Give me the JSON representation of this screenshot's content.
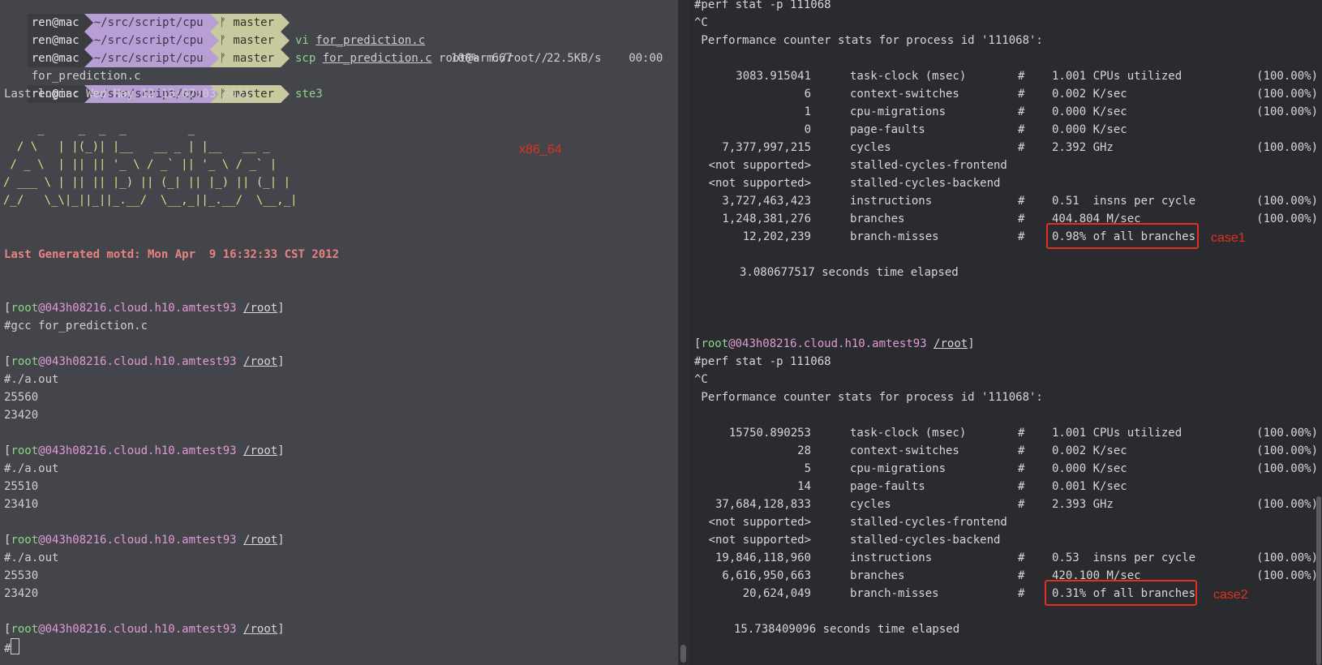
{
  "left": {
    "prompt": {
      "user": "ren@mac",
      "path": "~/src/script/cpu",
      "git": "ᚠ master"
    },
    "prompt_lines": [
      {
        "cmd": "",
        "arg": "",
        "rest": ""
      },
      {
        "cmd": "vi",
        "arg": "for_prediction.c",
        "rest": ""
      },
      {
        "cmd": "scp",
        "arg": "for_prediction.c",
        "rest": " root@arm:/root//"
      }
    ],
    "scp_progress": {
      "file": "for_prediction.c",
      "percent": "100%",
      "size": "667",
      "rate": "22.5KB/s",
      "time": "00:00"
    },
    "prompt_ssh": {
      "cmd": "ste3"
    },
    "last_login": "Last login: Wed May 12 13:07:03 2021",
    "ascii_art": "     _     _  _  _         _\n  / \\   | |(_)| |__   __ _ | |__   __ _\n / _ \\  | || || '_ \\ / _` || '_ \\ / _` |\n/ ___ \\ | || || |_) || (_| || |_) || (_| |\n/_/   \\_\\|_||_||_.__/  \\__,_||_.__/  \\__,_|",
    "arch_label": "x86_64",
    "motd": "Last Generated motd: Mon Apr  9 16:32:33 CST 2012",
    "host_prompt": {
      "user": "root",
      "at": "@",
      "host": "043h08216.cloud.h10.amtest93",
      "path": "/root"
    },
    "sessions": [
      {
        "cmd": "#gcc for_prediction.c",
        "out": []
      },
      {
        "cmd": "#./a.out",
        "out": [
          "25560",
          "23420"
        ]
      },
      {
        "cmd": "#./a.out",
        "out": [
          "25510",
          "23410"
        ]
      },
      {
        "cmd": "#./a.out",
        "out": [
          "25530",
          "23420"
        ]
      }
    ],
    "final_prompt": "#"
  },
  "right": {
    "top_cmd": "#perf stat -p 111068",
    "ctrl_c": "^C",
    "header": " Performance counter stats for process id '111068':",
    "case1": {
      "rows": [
        {
          "value": "3083.915041",
          "event": "task-clock (msec)",
          "hash": "#",
          "metric": "1.001 CPUs utilized",
          "pct": "(100.00%)"
        },
        {
          "value": "6",
          "event": "context-switches",
          "hash": "#",
          "metric": "0.002 K/sec",
          "pct": "(100.00%)"
        },
        {
          "value": "1",
          "event": "cpu-migrations",
          "hash": "#",
          "metric": "0.000 K/sec",
          "pct": "(100.00%)"
        },
        {
          "value": "0",
          "event": "page-faults",
          "hash": "#",
          "metric": "0.000 K/sec",
          "pct": ""
        },
        {
          "value": "7,377,997,215",
          "event": "cycles",
          "hash": "#",
          "metric": "2.392 GHz",
          "pct": "(100.00%)"
        },
        {
          "value": "<not supported>",
          "event": "stalled-cycles-frontend",
          "hash": "",
          "metric": "",
          "pct": ""
        },
        {
          "value": "<not supported>",
          "event": "stalled-cycles-backend",
          "hash": "",
          "metric": "",
          "pct": ""
        },
        {
          "value": "3,727,463,423",
          "event": "instructions",
          "hash": "#",
          "metric": "0.51  insns per cycle",
          "pct": "(100.00%)"
        },
        {
          "value": "1,248,381,276",
          "event": "branches",
          "hash": "#",
          "metric": "404.804 M/sec",
          "pct": "(100.00%)"
        },
        {
          "value": "12,202,239",
          "event": "branch-misses",
          "hash": "#",
          "metric": "0.98% of all branches",
          "pct": ""
        }
      ],
      "elapsed": "3.080677517 seconds time elapsed",
      "label": "case1"
    },
    "prompt": {
      "user": "root",
      "at": "@",
      "host": "043h08216.cloud.h10.amtest93",
      "path": "/root"
    },
    "second_cmd": "#perf stat -p 111068",
    "case2": {
      "rows": [
        {
          "value": "15750.890253",
          "event": "task-clock (msec)",
          "hash": "#",
          "metric": "1.001 CPUs utilized",
          "pct": "(100.00%)"
        },
        {
          "value": "28",
          "event": "context-switches",
          "hash": "#",
          "metric": "0.002 K/sec",
          "pct": "(100.00%)"
        },
        {
          "value": "5",
          "event": "cpu-migrations",
          "hash": "#",
          "metric": "0.000 K/sec",
          "pct": "(100.00%)"
        },
        {
          "value": "14",
          "event": "page-faults",
          "hash": "#",
          "metric": "0.001 K/sec",
          "pct": ""
        },
        {
          "value": "37,684,128,833",
          "event": "cycles",
          "hash": "#",
          "metric": "2.393 GHz",
          "pct": "(100.00%)"
        },
        {
          "value": "<not supported>",
          "event": "stalled-cycles-frontend",
          "hash": "",
          "metric": "",
          "pct": ""
        },
        {
          "value": "<not supported>",
          "event": "stalled-cycles-backend",
          "hash": "",
          "metric": "",
          "pct": ""
        },
        {
          "value": "19,846,118,960",
          "event": "instructions",
          "hash": "#",
          "metric": "0.53  insns per cycle",
          "pct": "(100.00%)"
        },
        {
          "value": "6,616,950,663",
          "event": "branches",
          "hash": "#",
          "metric": "420.100 M/sec",
          "pct": "(100.00%)"
        },
        {
          "value": "20,624,049",
          "event": "branch-misses",
          "hash": "#",
          "metric": "0.31% of all branches",
          "pct": ""
        }
      ],
      "elapsed": "15.738409096 seconds time elapsed",
      "label": "case2"
    }
  },
  "colors": {
    "highlight": "#e2301f",
    "prompt_green": "#8fd48a",
    "host_pink": "#e19ad3"
  }
}
